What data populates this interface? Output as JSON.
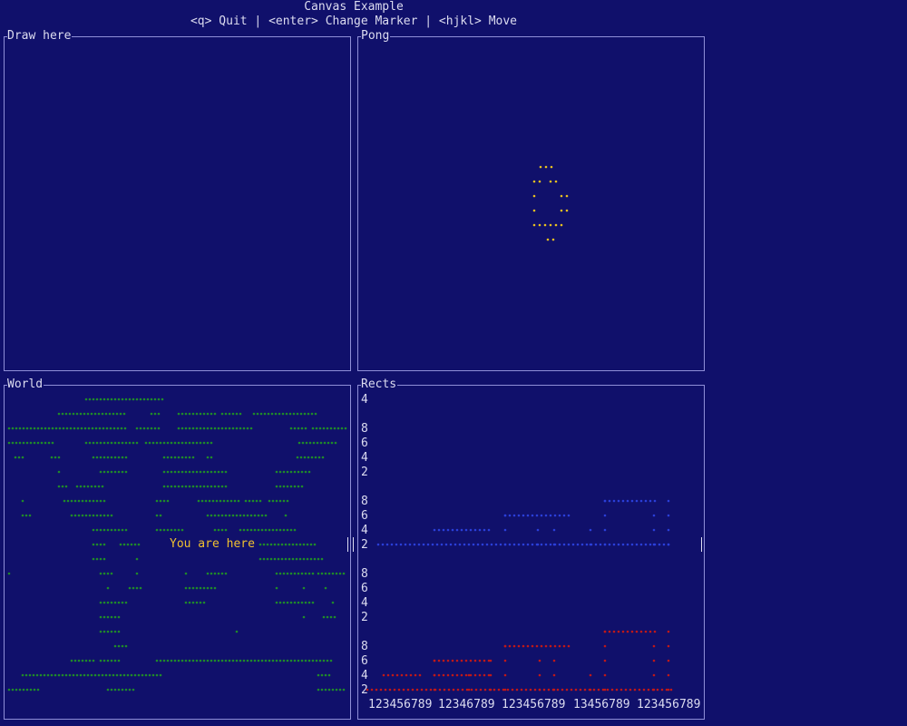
{
  "header": {
    "title": "Canvas Example",
    "help": "<q> Quit | <enter> Change Marker | <hjkl> Move"
  },
  "panels": {
    "draw": {
      "title": "Draw here"
    },
    "pong": {
      "title": "Pong"
    },
    "world": {
      "title": "World",
      "marker_label": "You are here"
    },
    "rects": {
      "title": "Rects",
      "y_labels": [
        "4",
        "8",
        "6",
        "4",
        "2",
        "8",
        "6",
        "4",
        "2",
        "8",
        "6",
        "4",
        "2",
        "8",
        "6",
        "4",
        "2"
      ],
      "x_labels": [
        "123456789",
        "12346789",
        "123456789",
        "13456789",
        "123456789"
      ]
    }
  },
  "colors": {
    "background": "#10106b",
    "border": "#8f8fd8",
    "text": "#dcdcf0",
    "ball": "#e8c020",
    "land": "#1f8a2a",
    "marker_label": "#f0c030",
    "blue_rects": "#2a3fd8",
    "red_rects": "#c01818"
  }
}
